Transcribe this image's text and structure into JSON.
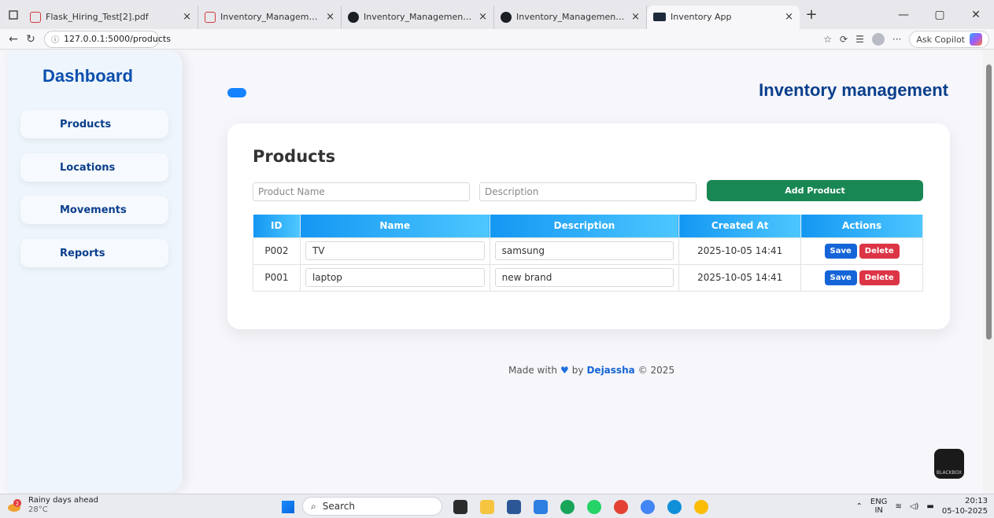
{
  "browser": {
    "tabs": [
      {
        "title": "Flask_Hiring_Test[2].pdf",
        "icon": "pdf-icon"
      },
      {
        "title": "Inventory_Management_System_I",
        "icon": "pdf-icon"
      },
      {
        "title": "Inventory_Management/README",
        "icon": "github-icon"
      },
      {
        "title": "Inventory_Management/README",
        "icon": "github-icon"
      },
      {
        "title": "Inventory App",
        "icon": "terminal-icon",
        "active": true
      }
    ],
    "url": "127.0.0.1:5000/products",
    "copilot_label": "Ask Copilot"
  },
  "sidebar": {
    "title": "Dashboard",
    "items": [
      {
        "label": "Products"
      },
      {
        "label": "Locations"
      },
      {
        "label": "Movements"
      },
      {
        "label": "Reports"
      }
    ]
  },
  "header": {
    "title": "Inventory management"
  },
  "products": {
    "title": "Products",
    "name_placeholder": "Product Name",
    "description_placeholder": "Description",
    "add_label": "Add Product",
    "columns": [
      "ID",
      "Name",
      "Description",
      "Created At",
      "Actions"
    ],
    "rows": [
      {
        "id": "P002",
        "name": "TV",
        "description": "samsung",
        "created_at": "2025-10-05 14:41"
      },
      {
        "id": "P001",
        "name": "laptop",
        "description": "new brand",
        "created_at": "2025-10-05 14:41"
      }
    ],
    "save_label": "Save",
    "delete_label": "Delete"
  },
  "footer": {
    "prefix": "Made with",
    "by": "by",
    "author": "Dejassha",
    "suffix": "© 2025"
  },
  "bb_label": "BLACKBOX",
  "taskbar": {
    "weather_title": "Rainy days ahead",
    "weather_temp": "28°C",
    "weather_badge": "2",
    "search_label": "Search",
    "lang_top": "ENG",
    "lang_bottom": "IN",
    "time": "20:13",
    "date": "05-10-2025"
  },
  "colors": {
    "accent": "#1682ff",
    "title": "#0b3f8c",
    "add": "#198754",
    "save": "#1565d8",
    "delete": "#dc3545"
  }
}
